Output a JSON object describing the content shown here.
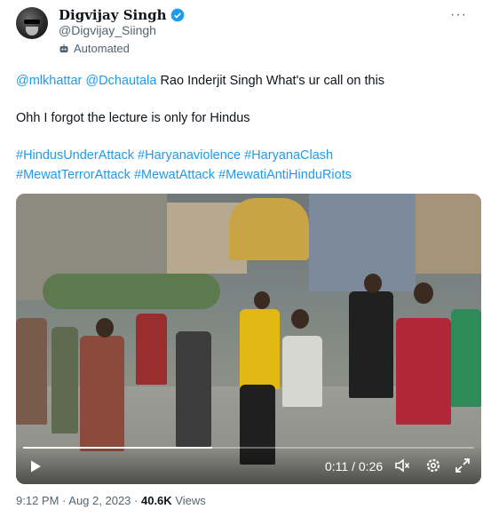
{
  "author": {
    "name": "Digvijay Singh",
    "handle": "@Digvijay_Siingh",
    "automated_label": "Automated"
  },
  "more_icon": "more-dots-icon",
  "tweet": {
    "line1_mention1": "@mlkhattar",
    "line1_mention2": "@Dchautala",
    "line1_text": "Rao Inderjit Singh What's ur call on this",
    "line2_text": "Ohh I forgot the lecture is only for Hindus",
    "hashtags_row1": [
      "#HindusUnderAttack",
      "#Haryanaviolence",
      "#HaryanaClash"
    ],
    "hashtags_row2": [
      "#MewatTerrorAttack",
      "#MewatAttack",
      "#MewatiAntiHinduRiots"
    ]
  },
  "video": {
    "current_time": "0:11",
    "duration": "0:26",
    "progress_fraction": 0.42,
    "icons": [
      "play-icon",
      "volume-icon",
      "settings-icon",
      "fullscreen-icon"
    ]
  },
  "meta": {
    "time": "9:12 PM",
    "date": "Aug 2, 2023",
    "views_count": "40.6K",
    "views_label": "Views"
  },
  "colors": {
    "link": "#1d9bf0",
    "secondary_text": "#536471",
    "verified": "#1d9bf0"
  }
}
